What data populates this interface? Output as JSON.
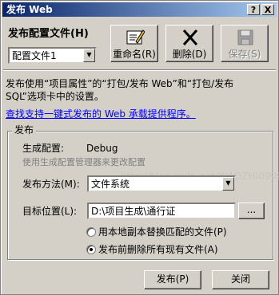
{
  "window": {
    "title": "发布 Web",
    "help_btn": "?",
    "close_btn": "X"
  },
  "profile": {
    "label": "发布配置文件(H)",
    "selected": "配置文件1"
  },
  "toolbar": {
    "rename": "重命名(R)",
    "delete": "删除(D)",
    "save": "保存(S)"
  },
  "description": {
    "line1": "发布使用“项目属性”的“打包/发布 Web”和“打包/发布",
    "line2": "SQL”选项卡中的设置。"
  },
  "link": {
    "text": "查找支持一键式发布的 Web 承载提供程序。"
  },
  "publish": {
    "group_title": "发布",
    "build_config_label": "生成配置:",
    "build_config_value": "Debug",
    "build_config_hint": "使用生成配置管理器来更改配置",
    "method_label": "发布方法(M):",
    "method_value": "文件系统",
    "target_label": "目标位置(L):",
    "target_value": "D:\\项目生成\\通行证",
    "browse_label": "...",
    "radio_replace": "用本地副本替换匹配的文件(P)",
    "radio_delete": "发布前删除所有现有文件(A)",
    "selected_option": "radio_delete"
  },
  "watermark": "http://blog.csdn.net/XIAOZHI0999",
  "footer": {
    "publish": "发布(P)",
    "close": "关闭"
  }
}
